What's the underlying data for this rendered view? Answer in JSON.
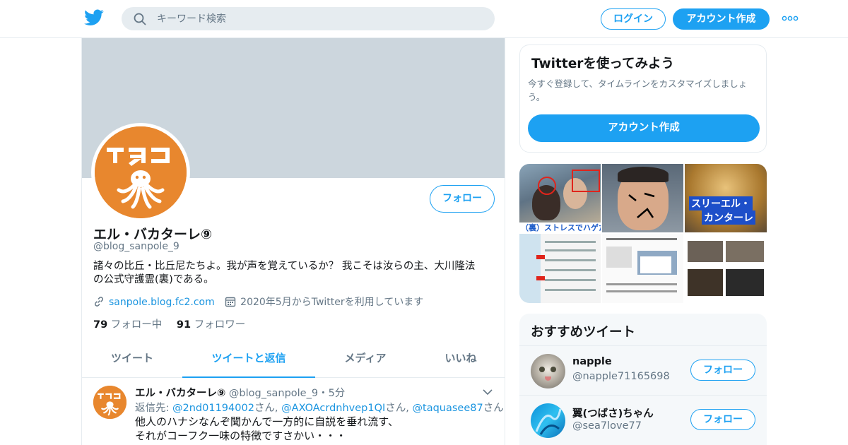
{
  "header": {
    "search_placeholder": "キーワード検索",
    "login_label": "ログイン",
    "signup_label": "アカウント作成"
  },
  "profile": {
    "avatar_logo_text": "TAKO",
    "follow_label": "フォロー",
    "display_name": "エル・バカターレ⑨",
    "handle": "@blog_sanpole_9",
    "bio_line1": "諸々の比丘・比丘尼たちよ。我が声を覚えているか？ 我こそは汝らの主、大川隆法",
    "bio_line2": "の公式守護霊(裏)である。",
    "url": "sanpole.blog.fc2.com",
    "joined": "2020年5月からTwitterを利用しています",
    "following_count": "79",
    "following_label": "フォロー中",
    "followers_count": "91",
    "followers_label": "フォロワー"
  },
  "tabs": [
    {
      "label": "ツイート"
    },
    {
      "label": "ツイートと返信"
    },
    {
      "label": "メディア"
    },
    {
      "label": "いいね"
    }
  ],
  "tweet": {
    "name": "エル・バカターレ⑨",
    "handle_time": "@blog_sanpole_9・5分",
    "reply_prefix": "返信先:",
    "reply_user1": "@2nd01194002",
    "reply_san1": "さん,",
    "reply_user2": "@AXOAcrdnhvep1QI",
    "reply_san2": "さん,",
    "reply_user3": "@taquasee87",
    "reply_san3": "さん",
    "line1": "他人のハナシなんぞ聞かんで一方的に自説を垂れ流す、",
    "line2": "それがコーフク一味の特徴ですさかい・・・"
  },
  "signup_card": {
    "title": "Twitterを使ってみよう",
    "desc_line1": "今すぐ登録して、タイムラインをカスタマイズしましょ",
    "desc_line2": "う。",
    "button": "アカウント作成"
  },
  "media": {
    "caption1": "（裏）ストレスでハゲた～",
    "caption3a": "スリーエル・",
    "caption3b": "カンターレ"
  },
  "recommended": {
    "title": "おすすめツイート",
    "items": [
      {
        "name": "napple",
        "handle": "@napple71165698",
        "follow": "フォロー"
      },
      {
        "name": "翼(つばさ)ちゃん",
        "handle": "@sea7love77",
        "follow": "フォロー"
      }
    ]
  },
  "colors": {
    "accent": "#1da1f2",
    "avatar_orange": "#e8872e",
    "banner": "#ccd6dd"
  }
}
